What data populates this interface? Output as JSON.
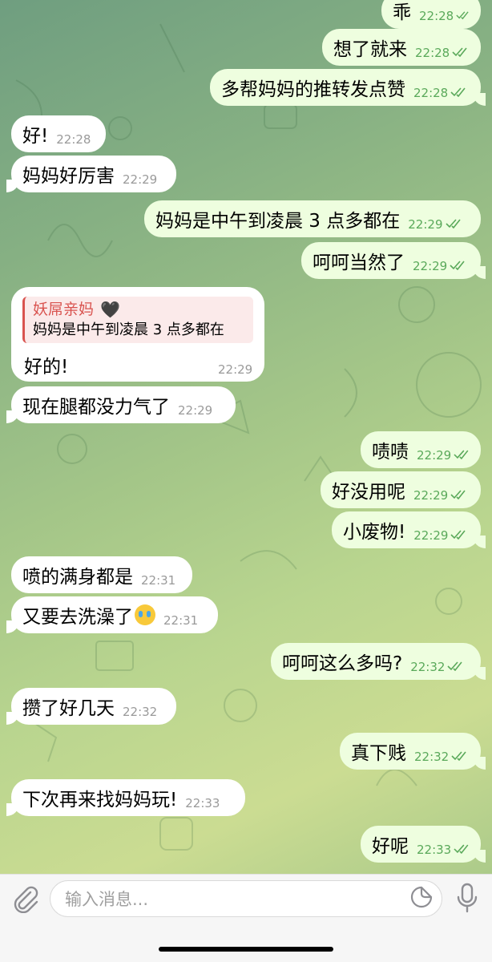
{
  "messages": [
    {
      "text": "乖",
      "time": "22:28",
      "dir": "out"
    },
    {
      "text": "想了就来",
      "time": "22:28",
      "dir": "out"
    },
    {
      "text": "多帮妈妈的推转发点赞",
      "time": "22:28",
      "dir": "out"
    },
    {
      "text": "好!",
      "time": "22:28",
      "dir": "in"
    },
    {
      "text": "妈妈好厉害",
      "time": "22:29",
      "dir": "in"
    },
    {
      "text": "妈妈是中午到凌晨 3 点多都在",
      "time": "22:29",
      "dir": "out"
    },
    {
      "text": "呵呵当然了",
      "time": "22:29",
      "dir": "out"
    },
    {
      "text": "好的!",
      "time": "22:29",
      "dir": "in",
      "reply_to": {
        "name": "妖屌亲妈",
        "text": "妈妈是中午到凌晨 3 点多都在",
        "emoji": "🖤"
      }
    },
    {
      "text": "现在腿都没力气了",
      "time": "22:29",
      "dir": "in"
    },
    {
      "text": "啧啧",
      "time": "22:29",
      "dir": "out"
    },
    {
      "text": "好没用呢",
      "time": "22:29",
      "dir": "out"
    },
    {
      "text": "小废物!",
      "time": "22:29",
      "dir": "out"
    },
    {
      "text": "喷的满身都是",
      "time": "22:31",
      "dir": "in"
    },
    {
      "text": "又要去洗澡了",
      "time": "22:31",
      "dir": "in",
      "emoji": "😭"
    },
    {
      "text": "呵呵这么多吗?",
      "time": "22:32",
      "dir": "out"
    },
    {
      "text": "攒了好几天",
      "time": "22:32",
      "dir": "in"
    },
    {
      "text": "真下贱",
      "time": "22:32",
      "dir": "out"
    },
    {
      "text": "下次再来找妈妈玩!",
      "time": "22:33",
      "dir": "in"
    },
    {
      "text": "好呢",
      "time": "22:33",
      "dir": "out"
    }
  ],
  "composer": {
    "placeholder": "输入消息..."
  },
  "icons": {
    "attach": "paperclip-icon",
    "sticker": "sticker-icon",
    "mic": "microphone-icon",
    "read_receipt": "double-check-icon"
  },
  "colors": {
    "incoming_bubble": "#ffffff",
    "outgoing_bubble": "#eefedf",
    "outgoing_time": "#5aa95a",
    "reply_accent": "#d9534f"
  }
}
